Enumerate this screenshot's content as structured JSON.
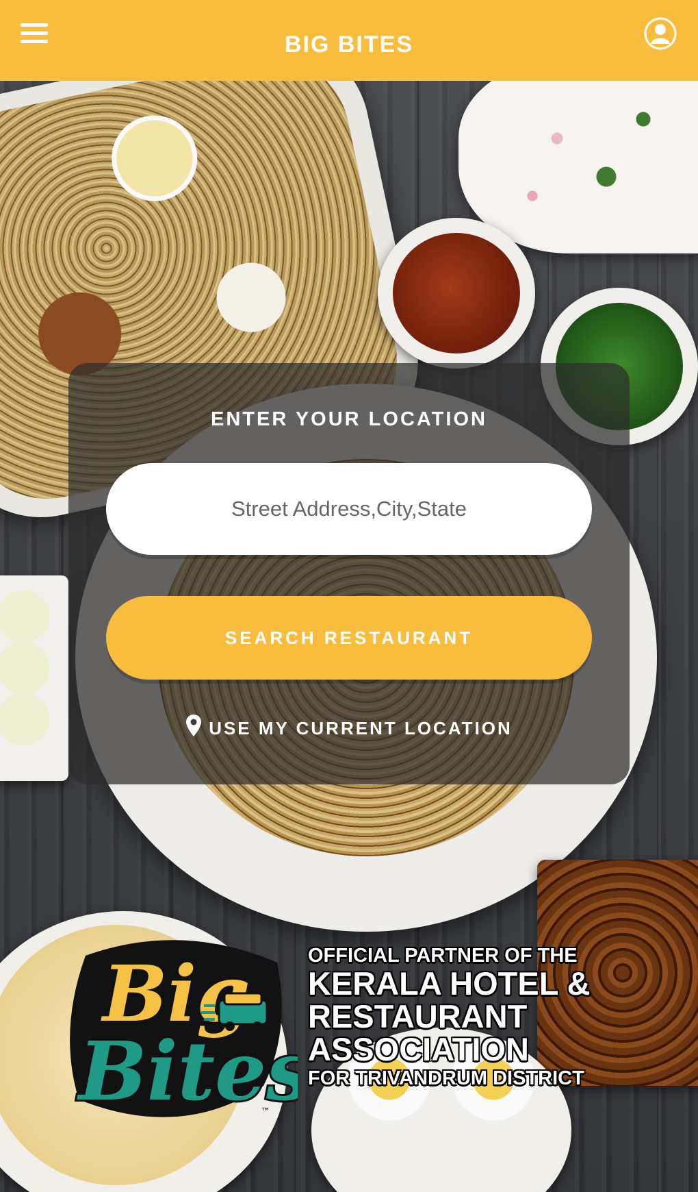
{
  "app_bar": {
    "title": "BIG BITES",
    "menu_icon": "hamburger-menu-icon",
    "profile_icon": "user-profile-icon"
  },
  "location_card": {
    "heading": "ENTER YOUR LOCATION",
    "input_placeholder": "Street Address,City,State",
    "input_value": "",
    "search_button_label": "SEARCH RESTAURANT",
    "current_location_label": "USE MY CURRENT LOCATION",
    "current_location_icon": "map-pin-icon"
  },
  "logo": {
    "line1": "Big",
    "line2": "Bites",
    "trademark": "™"
  },
  "partner": {
    "line1": "OFFICIAL PARTNER OF THE",
    "line2": "KERALA HOTEL &",
    "line3": "RESTAURANT",
    "line4": "ASSOCIATION",
    "line5": "FOR TRIVANDRUM DISTRICT"
  },
  "colors": {
    "accent": "#f8bd3c",
    "logo_yellow": "#f5c245",
    "logo_teal": "#1e9a86"
  }
}
